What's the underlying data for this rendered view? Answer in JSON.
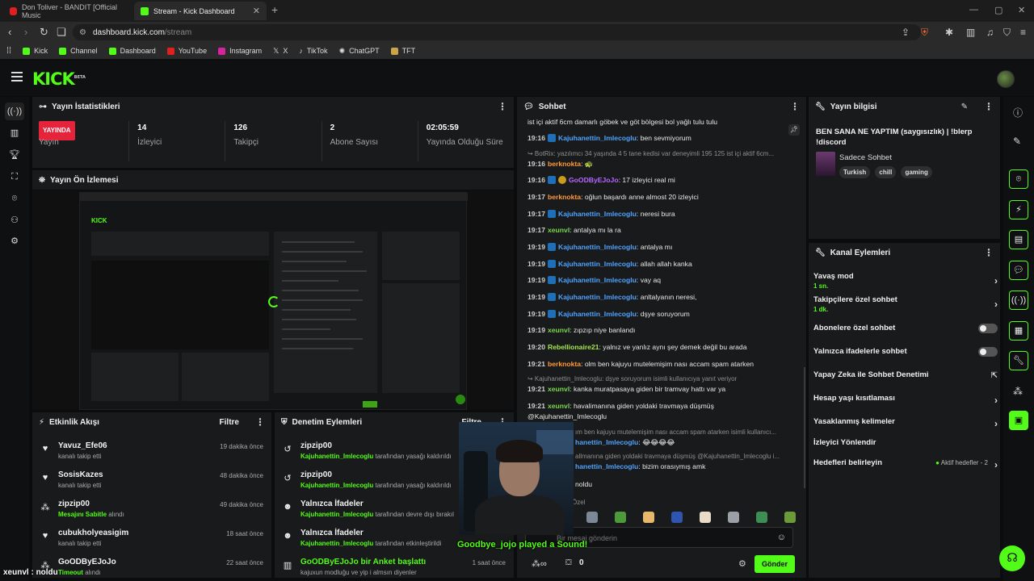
{
  "browser": {
    "tabs": [
      {
        "title": "Don Toliver - BANDIT [Official Music",
        "active": false
      },
      {
        "title": "Stream - Kick Dashboard",
        "active": true
      }
    ],
    "url_host": "dashboard.kick.com",
    "url_path": "/stream",
    "bookmarks": [
      "Kick",
      "Channel",
      "Dashboard",
      "YouTube",
      "Instagram",
      "X",
      "TikTok",
      "ChatGPT",
      "TFT"
    ]
  },
  "kick": {
    "logo": "KICK",
    "logo_sup": "BETA"
  },
  "stats_panel": {
    "title": "Yayın İstatistikleri",
    "live_badge": "YAYINDA",
    "stats": [
      {
        "value": "",
        "label": "Yayın"
      },
      {
        "value": "14",
        "label": "İzleyici"
      },
      {
        "value": "126",
        "label": "Takipçi"
      },
      {
        "value": "2",
        "label": "Abone Sayısı"
      },
      {
        "value": "02:05:59",
        "label": "Yayında Olduğu Süre"
      }
    ]
  },
  "preview_panel": {
    "title": "Yayın Ön İzlemesi"
  },
  "activity_panel": {
    "title": "Etkinlik Akışı",
    "filter": "Filtre",
    "items": [
      {
        "name": "Yavuz_Efe06",
        "sub": "kanalı takip etti",
        "sub_highlight": "",
        "time": "19 dakika önce",
        "icon": "heart-icon"
      },
      {
        "name": "SosisKazes",
        "sub": "kanalı takip etti",
        "sub_highlight": "",
        "time": "48 dakika önce",
        "icon": "heart-icon"
      },
      {
        "name": "zipzip00",
        "sub": "alındı",
        "sub_highlight": "Mesajını Sabitle",
        "time": "49 dakika önce",
        "icon": "points-icon"
      },
      {
        "name": "cubukholyeasigim",
        "sub": "kanalı takip etti",
        "sub_highlight": "",
        "time": "18 saat önce",
        "icon": "heart-icon"
      },
      {
        "name": "GoODByEJoJo",
        "sub": "alındı",
        "sub_highlight": "Timeout",
        "time": "22 saat önce",
        "icon": "points-icon"
      }
    ]
  },
  "mod_panel": {
    "title": "Denetim Eylemleri",
    "filter": "Filtre",
    "items": [
      {
        "name": "zipzip00",
        "actor": "Kajuhanettin_Imlecoglu",
        "sub": "tarafından yasağı kaldırıldı",
        "time": "",
        "icon": "undo-icon"
      },
      {
        "name": "zipzip00",
        "actor": "Kajuhanettin_Imlecoglu",
        "sub": "tarafından yasağı kaldırıldı",
        "time": "",
        "icon": "undo-icon"
      },
      {
        "name": "Yalnızca İfadeler",
        "actor": "Kajuhanettin_Imlecoglu",
        "sub": "tarafından devre dışı bırakıl",
        "time": "",
        "icon": "emoji-icon"
      },
      {
        "name": "Yalnızca İfadeler",
        "actor": "Kajuhanettin_Imlecoglu",
        "sub": "tarafından etkinleştirildi",
        "time": "",
        "icon": "emoji-icon"
      },
      {
        "name": "GoODByEJoJo bir Anket başlattı",
        "actor": "",
        "sub": "kajuxun modluğu ve yip i almsın diyenler",
        "time": "1 saat önce",
        "icon": "poll-icon"
      }
    ]
  },
  "chat": {
    "title": "Sohbet",
    "messages": [
      {
        "time": "",
        "user": "",
        "user_color": "",
        "text": "ist içi aktif 6cm damarlı göbek ve göt bölgesi bol yağlı tulu tulu",
        "badges": 0,
        "reply": false
      },
      {
        "time": "19:16",
        "user": "Kajuhanettin_Imlecoglu",
        "user_color": "c-blue",
        "text": ": ben sevmiyorum",
        "badges": 1,
        "reply": false
      },
      {
        "time": "",
        "user": "",
        "user_color": "",
        "text": "↪ BotRix: yazılımcı 34 yaşında 4 5 tane kedisi var deneyimli 195 125 ist içi aktif 6cm...",
        "badges": 0,
        "reply": true
      },
      {
        "time": "19:16",
        "user": "berknokta",
        "user_color": "c-orange",
        "text": ": 🐢",
        "badges": 0,
        "reply": false
      },
      {
        "time": "19:16",
        "user": "GoODByEJoJo",
        "user_color": "c-purple",
        "text": ": 17 izleyici real mi",
        "badges": 2,
        "reply": false
      },
      {
        "time": "19:17",
        "user": "berknokta",
        "user_color": "c-orange",
        "text": ": oğlun başardı anne almost 20 izleyici",
        "badges": 0,
        "reply": false
      },
      {
        "time": "19:17",
        "user": "Kajuhanettin_Imlecoglu",
        "user_color": "c-blue",
        "text": ": neresi bura",
        "badges": 1,
        "reply": false
      },
      {
        "time": "19:17",
        "user": "xeunvl",
        "user_color": "c-green",
        "text": ": antalya mı la ra",
        "badges": 0,
        "reply": false
      },
      {
        "time": "19:19",
        "user": "Kajuhanettin_Imlecoglu",
        "user_color": "c-blue",
        "text": ": antalya mı",
        "badges": 1,
        "reply": false
      },
      {
        "time": "19:19",
        "user": "Kajuhanettin_Imlecoglu",
        "user_color": "c-blue",
        "text": ": allah allah kanka",
        "badges": 1,
        "reply": false
      },
      {
        "time": "19:19",
        "user": "Kajuhanettin_Imlecoglu",
        "user_color": "c-blue",
        "text": ": vay aq",
        "badges": 1,
        "reply": false
      },
      {
        "time": "19:19",
        "user": "Kajuhanettin_Imlecoglu",
        "user_color": "c-blue",
        "text": ": anltalyanın neresi,",
        "badges": 1,
        "reply": false
      },
      {
        "time": "19:19",
        "user": "Kajuhanettin_Imlecoglu",
        "user_color": "c-blue",
        "text": ": dşye soruyorum",
        "badges": 1,
        "reply": false
      },
      {
        "time": "19:19",
        "user": "xeunvl",
        "user_color": "c-green",
        "text": ": zıpzıp niye banlandı",
        "badges": 0,
        "reply": false
      },
      {
        "time": "19:20",
        "user": "Rebellionaire21",
        "user_color": "c-lime",
        "text": ": yalnız ve yanlız aynı şey demek değil bu arada",
        "badges": 0,
        "reply": false
      },
      {
        "time": "19:21",
        "user": "berknokta",
        "user_color": "c-orange",
        "text": ": olm ben kajuyu mutelemişim nası accam spam atarken",
        "badges": 0,
        "reply": false
      },
      {
        "time": "",
        "user": "",
        "user_color": "",
        "text": "↪ Kajuhanettin_Imlecoglu: dşye soruyorum isimli kullanıcıya yanıt veriyor",
        "badges": 0,
        "reply": true
      },
      {
        "time": "19:21",
        "user": "xeunvl",
        "user_color": "c-green",
        "text": ": kanka muratpasaya giden bir tramvay hattı var ya",
        "badges": 0,
        "reply": false
      },
      {
        "time": "19:21",
        "user": "xeunvl",
        "user_color": "c-green",
        "text": ": havalimanına giden yoldaki travmaya düşmüş",
        "badges": 0,
        "reply": false
      },
      {
        "time": "",
        "user": "",
        "user_color": "",
        "text": "@Kajuhanettin_Imlecoglu",
        "badges": 0,
        "reply": false
      },
      {
        "time": "",
        "user": "",
        "user_color": "",
        "text": "ım ben kajuyu mutelemişim nası accam spam atarken isimli kullanıcı...",
        "badges": 0,
        "reply": true
      },
      {
        "time": "",
        "user": "hanettin_Imlecoglu",
        "user_color": "c-blue",
        "text": ": 😂😂😂😂",
        "badges": 0,
        "reply": false
      },
      {
        "time": "",
        "user": "",
        "user_color": "",
        "text": "allmanına giden yoldaki travmaya düşmüş @Kajuhanettin_Imlecoglu i...",
        "badges": 0,
        "reply": true
      },
      {
        "time": "",
        "user": "hanettin_Imlecoglu",
        "user_color": "c-blue",
        "text": ": bizim orasıymış amk",
        "badges": 0,
        "reply": false
      },
      {
        "time": "",
        "user": "",
        "user_color": "",
        "text": "noldu",
        "badges": 0,
        "reply": false
      },
      {
        "time": "",
        "user": "",
        "user_color": "",
        "text": "Özel",
        "badges": 0,
        "reply": true
      }
    ],
    "input_placeholder": "Bir mesaj gönderin",
    "send_label": "Gönder",
    "points_count": "0"
  },
  "stream_info": {
    "title": "Yayın bilgisi",
    "stream_title": "BEN SANA NE YAPTIM (saygısızlık) | !blerp !discord",
    "category": "Sadece Sohbet",
    "tags": [
      "Turkish",
      "chill",
      "gaming"
    ]
  },
  "channel_actions": {
    "title": "Kanal Eylemleri",
    "items": [
      {
        "label": "Yavaş mod",
        "sub": "1 sn.",
        "control": "chevron"
      },
      {
        "label": "Takipçilere özel sohbet",
        "sub": "1 dk.",
        "control": "chevron"
      },
      {
        "label": "Abonelere özel sohbet",
        "sub": "",
        "control": "toggle"
      },
      {
        "label": "Yalnızca ifadelerle sohbet",
        "sub": "",
        "control": "toggle"
      },
      {
        "label": "Yapay Zeka ile Sohbet Denetimi",
        "sub": "",
        "control": "external"
      },
      {
        "label": "Hesap yaşı kısıtlaması",
        "sub": "",
        "control": "chevron"
      },
      {
        "label": "Yasaklanmış kelimeler",
        "sub": "",
        "control": "chevron"
      },
      {
        "label": "İzleyici Yönlendir",
        "sub": "",
        "control": "none"
      },
      {
        "label": "Hedefleri belirleyin",
        "sub": "",
        "control": "goals"
      }
    ],
    "goals_status": "Aktif hedefler - 2"
  },
  "overlay": {
    "sound_text": "Goodbye_jojo played a Sound!",
    "chat_line": "xeunvl : noldu"
  }
}
